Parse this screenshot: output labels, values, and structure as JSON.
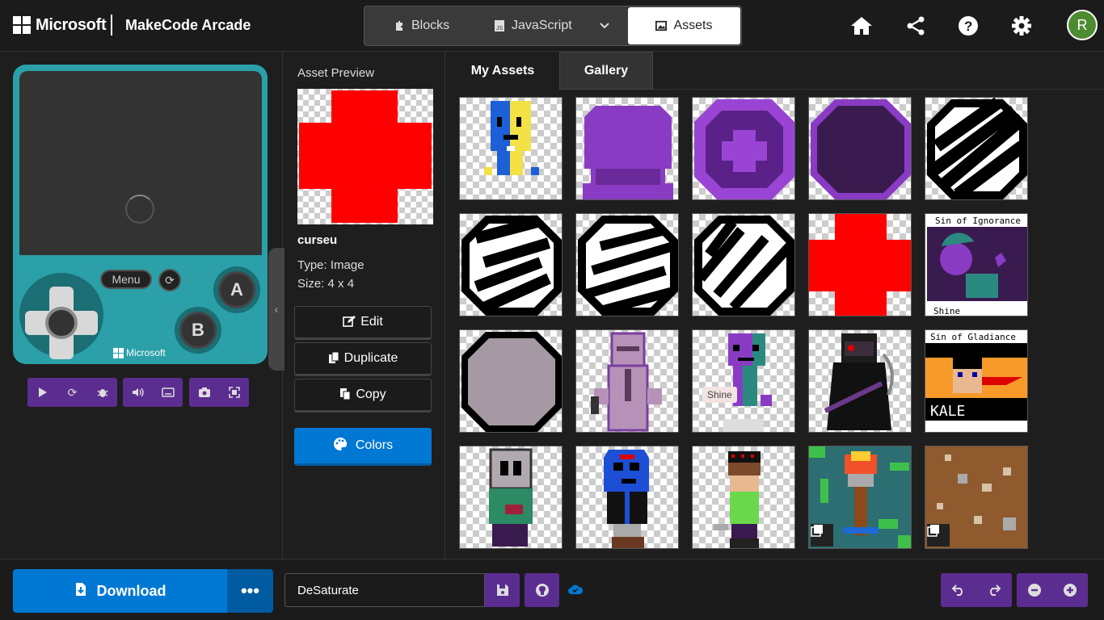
{
  "header": {
    "ms_label": "Microsoft",
    "app_title": "MakeCode Arcade",
    "tabs": {
      "blocks": "Blocks",
      "javascript": "JavaScript",
      "assets": "Assets"
    },
    "avatar_initial": "R"
  },
  "simulator": {
    "menu_label": "Menu",
    "a_label": "A",
    "b_label": "B",
    "brand": "Microsoft",
    "device_color": "#2ba0a8"
  },
  "asset_panel": {
    "preview_label": "Asset Preview",
    "name": "curseu",
    "type": "Type: Image",
    "size": "Size: 4 x 4",
    "edit": "Edit",
    "duplicate": "Duplicate",
    "copy": "Copy",
    "colors": "Colors"
  },
  "gallery": {
    "tabs": {
      "mine": "My Assets",
      "gallery": "Gallery"
    },
    "tile_text_shine": "Shine",
    "tiles": [
      "character-blue-yellow",
      "purple-dome",
      "purple-ring-plus",
      "dark-purple-circle",
      "black-scribble-circle",
      "scribble-circle-2",
      "scribble-circle-3",
      "scribble-circle-4",
      "red-cross",
      "sin-of-ignorance",
      "grey-circle",
      "purple-suit-figure",
      "purple-green-figure",
      "dark-reaper",
      "sin-of-gladiance",
      "grey-skull-figure",
      "blue-hood-figure",
      "crowned-kid",
      "torch-tile",
      "dirt-tile"
    ]
  },
  "footer": {
    "download": "Download",
    "more": "•••",
    "project_name": "DeSaturate"
  },
  "colors": {
    "accent": "#0078d4",
    "purple": "#5c2d91",
    "teal": "#2ba0a8"
  }
}
